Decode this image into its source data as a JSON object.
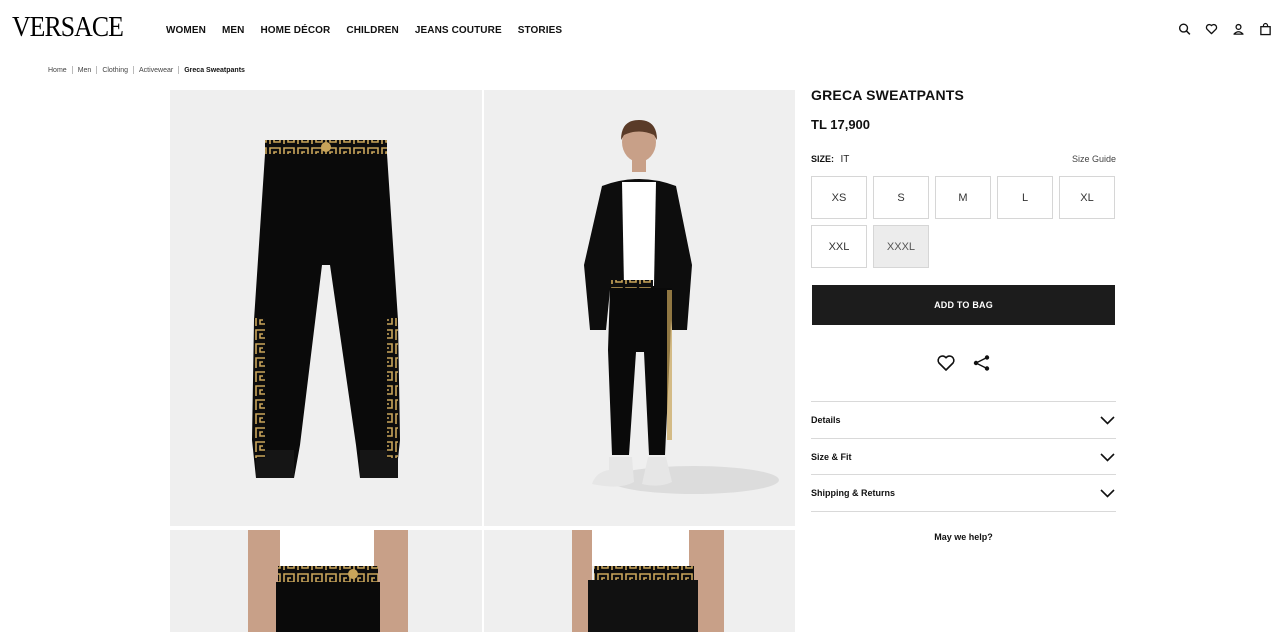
{
  "brand": {
    "logo": "VERSACE"
  },
  "nav": {
    "items": [
      "WOMEN",
      "MEN",
      "HOME DÉCOR",
      "CHILDREN",
      "JEANS COUTURE",
      "STORIES"
    ]
  },
  "header_icons": [
    "search-icon",
    "heart-icon",
    "account-icon",
    "bag-icon"
  ],
  "breadcrumb": {
    "items": [
      "Home",
      "Men",
      "Clothing",
      "Activewear"
    ],
    "current": "Greca Sweatpants"
  },
  "product": {
    "title": "GRECA SWEATPANTS",
    "price": "TL 17,900",
    "size_label": "SIZE:",
    "size_system": "IT",
    "size_guide": "Size Guide",
    "sizes": [
      {
        "label": "XS",
        "available": true
      },
      {
        "label": "S",
        "available": true
      },
      {
        "label": "M",
        "available": true
      },
      {
        "label": "L",
        "available": true
      },
      {
        "label": "XL",
        "available": true
      },
      {
        "label": "XXL",
        "available": true
      },
      {
        "label": "XXXL",
        "available": false
      }
    ],
    "add_to_bag": "ADD TO BAG",
    "actions": [
      "heart-icon",
      "share-icon"
    ]
  },
  "accordion": {
    "items": [
      "Details",
      "Size & Fit",
      "Shipping & Returns"
    ]
  },
  "help": {
    "label": "May we help?"
  },
  "colors": {
    "accent": "#1c1c1c",
    "gold": "#c9a55a",
    "tile_bg": "#efefef"
  }
}
